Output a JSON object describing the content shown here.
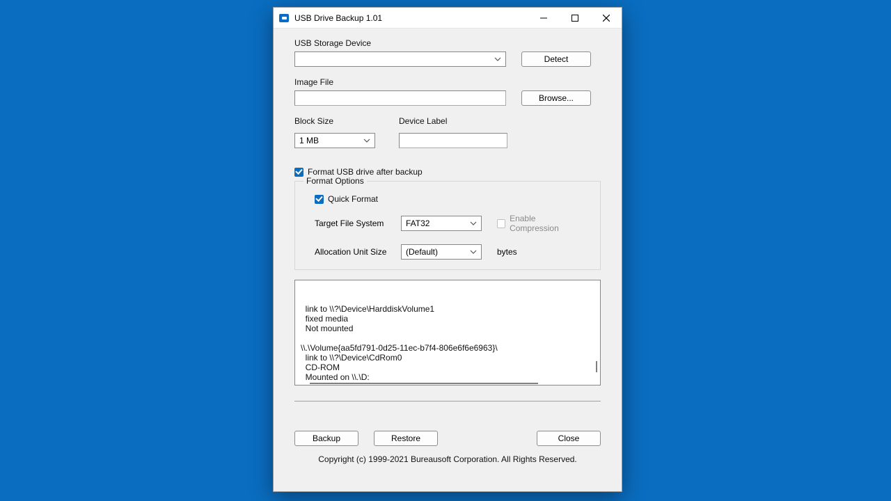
{
  "window": {
    "title": "USB Drive Backup 1.01"
  },
  "labels": {
    "usb_device": "USB Storage Device",
    "image_file": "Image File",
    "block_size": "Block Size",
    "device_label": "Device Label",
    "format_after": "Format USB drive after backup",
    "format_options": "Format Options",
    "quick_format": "Quick Format",
    "target_fs": "Target File System",
    "enable_compression": "Enable Compression",
    "alloc_unit": "Allocation Unit Size",
    "bytes": "bytes"
  },
  "buttons": {
    "detect": "Detect",
    "browse": "Browse...",
    "backup": "Backup",
    "restore": "Restore",
    "close": "Close"
  },
  "values": {
    "usb_device": "",
    "image_file": "",
    "block_size": "1 MB",
    "device_label": "",
    "target_fs": "FAT32",
    "alloc_unit": "(Default)"
  },
  "checks": {
    "format_after": true,
    "quick_format": true,
    "enable_compression": false
  },
  "log_text": "  link to \\\\?\\Device\\HarddiskVolume1\n  fixed media\n  Not mounted\n\n\\\\.\\Volume{aa5fd791-0d25-11ec-b7f4-806e6f6e6963}\\\n  link to \\\\?\\Device\\CdRom0\n  CD-ROM\n  Mounted on \\\\.\\D:\n",
  "copyright": "Copyright (c) 1999-2021 Bureausoft Corporation. All Rights Reserved."
}
